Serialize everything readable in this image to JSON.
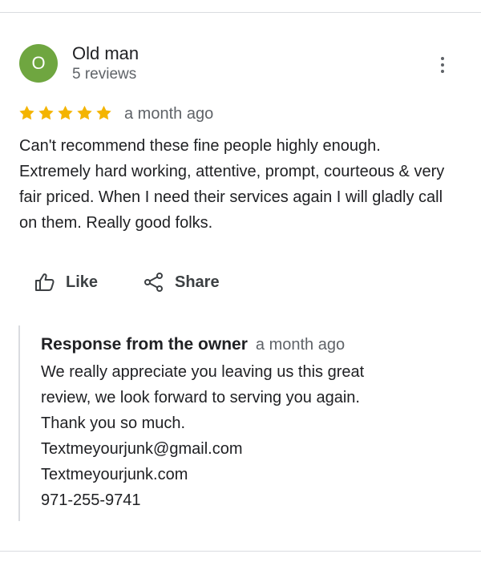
{
  "review": {
    "avatar_letter": "O",
    "avatar_color": "#6fa640",
    "reviewer_name": "Old man",
    "review_count": "5 reviews",
    "rating": 5,
    "date": "a month ago",
    "text": "Can't recommend these fine people highly enough. Extremely hard working, attentive, prompt, courteous & very fair priced. When I need their services again I will gladly call on them. Really good folks."
  },
  "actions": {
    "like_label": "Like",
    "share_label": "Share"
  },
  "owner_response": {
    "title": "Response from the owner",
    "date": "a month ago",
    "lines": [
      "We really appreciate you leaving us this great",
      "review, we look forward to serving you again.",
      "Thank you so much.",
      "Textmeyourjunk@gmail.com",
      "Textmeyourjunk.com",
      "971-255-9741"
    ]
  },
  "colors": {
    "star": "#f4b400",
    "secondary_text": "#5f6368",
    "divider": "#dadce0"
  },
  "icons": [
    "more-vert-icon",
    "star-icon",
    "thumb-up-icon",
    "share-icon"
  ]
}
